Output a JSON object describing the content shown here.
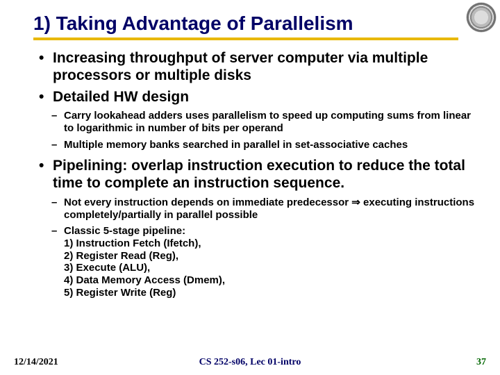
{
  "title": "1) Taking Advantage of Parallelism",
  "bullets": {
    "b1": "Increasing throughput of server computer via multiple processors or multiple disks",
    "b2": "Detailed HW design",
    "b2_subs": {
      "s1": "Carry lookahead adders uses parallelism to speed up computing sums from linear to logarithmic in number of bits per operand",
      "s2": "Multiple memory banks searched in parallel in set-associative caches"
    },
    "b3": "Pipelining: overlap instruction execution to reduce the total time to complete an instruction sequence.",
    "b3_subs": {
      "s1_pre": "Not every instruction depends on immediate predecessor ",
      "s1_arrow": "⇒",
      "s1_post": " executing instructions completely/partially in parallel possible",
      "s2_head": "Classic 5-stage pipeline:",
      "s2_l1": "1) Instruction Fetch (Ifetch),",
      "s2_l2": "2) Register Read (Reg),",
      "s2_l3": "3) Execute (ALU),",
      "s2_l4": "4) Data Memory Access (Dmem),",
      "s2_l5": "5) Register Write (Reg)"
    }
  },
  "footer": {
    "date": "12/14/2021",
    "center": "CS 252-s06, Lec 01-intro",
    "page": "37"
  }
}
